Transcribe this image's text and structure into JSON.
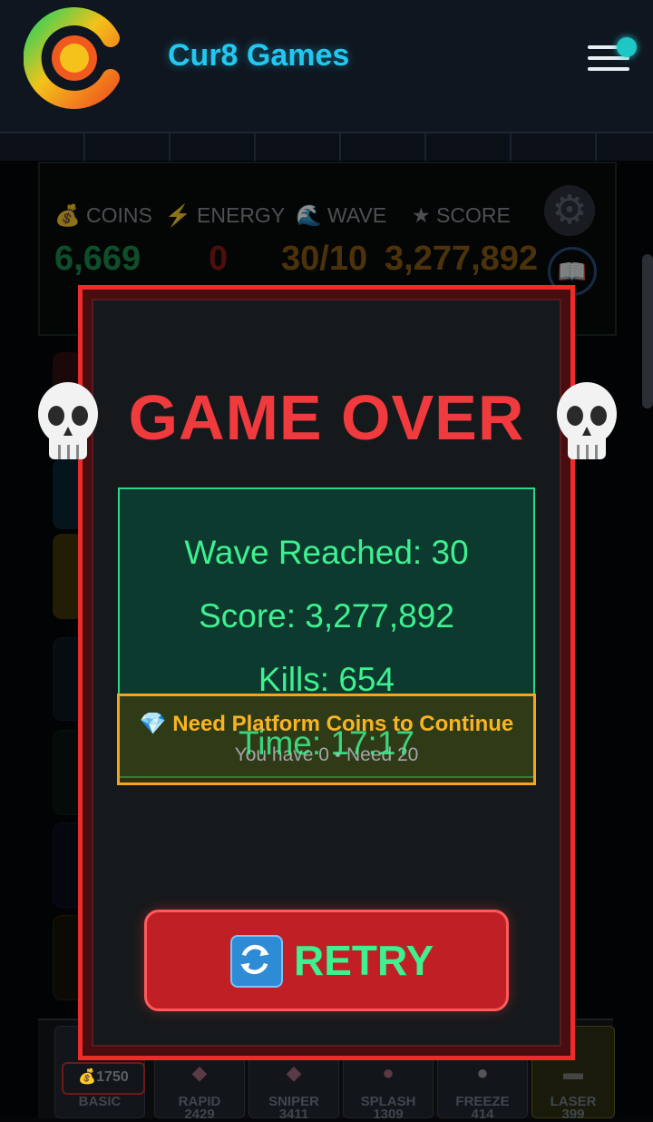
{
  "app": {
    "title": "Cur8 Games"
  },
  "hud": {
    "coins_label": "COINS",
    "coins_value": "6,669",
    "energy_label": "ENERGY",
    "energy_value": "0",
    "wave_label": "WAVE",
    "wave_value": "30/10",
    "score_label": "SCORE",
    "score_value": "3,277,892"
  },
  "modal": {
    "title": "GAME OVER",
    "stats": {
      "wave": "Wave Reached: 30",
      "score": "Score: 3,277,892",
      "kills": "Kills: 654",
      "time": "Time: 17:17"
    },
    "coins_notice": {
      "title": "Need Platform Coins to Continue",
      "subtitle": "You have 0 • Need 20"
    },
    "retry_label": "RETRY"
  },
  "towers": [
    {
      "name": "BASIC",
      "cost": "1750"
    },
    {
      "name": "RAPID",
      "cost": "2429"
    },
    {
      "name": "SNIPER",
      "cost": "3411"
    },
    {
      "name": "SPLASH",
      "cost": "1309"
    },
    {
      "name": "FREEZE",
      "cost": "414"
    },
    {
      "name": "LASER",
      "cost": "399"
    }
  ],
  "icons": {
    "coins": "moneybag-icon",
    "energy": "lightning-icon",
    "wave": "wave-icon",
    "score": "star-icon",
    "settings": "gear-icon",
    "guide": "book-icon",
    "skull": "skull-icon",
    "gem": "diamond-icon",
    "retry": "refresh-icon",
    "menu": "hamburger-icon"
  },
  "colors": {
    "brand": "#22c8f0",
    "danger": "#f03a3e",
    "success": "#3ef08f",
    "warning": "#f7b423",
    "modal_border": "#ee2b2b"
  }
}
